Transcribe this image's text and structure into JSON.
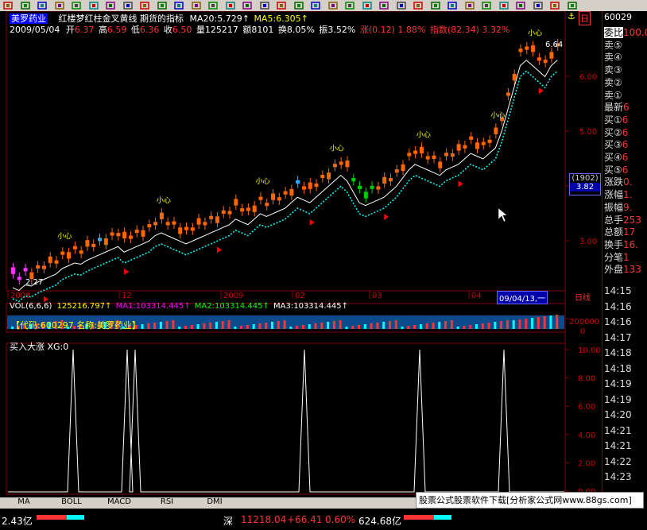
{
  "toolbar": {
    "icons": [
      "bar-chart-icon",
      "up-icon",
      "down-icon",
      "left-icon",
      "right-icon",
      "zoom-in-icon",
      "zoom-out-icon",
      "square-icon",
      "tool-icon",
      "pen-icon",
      "info-icon",
      "chart-icon",
      "line-icon",
      "grid-icon",
      "calc-icon",
      "table-icon",
      "formula-icon",
      "chart2-icon",
      "chart3-icon",
      "mail-icon",
      "calendar-icon",
      "monitor-icon",
      "close-icon",
      "question-icon",
      "search-icon",
      "person-icon",
      "eye-icon",
      "flag-icon",
      "refresh-icon",
      "image-icon",
      "doc-icon",
      "wifi-icon",
      "cross-icon",
      "help-icon"
    ]
  },
  "header": {
    "stock_name": "美罗药业",
    "indicator_title": "红楼梦红柱金叉黄线 期货的指标",
    "ma20_label": "MA20:5.729",
    "ma5_label": "MA5:6.305",
    "date": "2009/05/04",
    "open_label": "开",
    "open": "6.37",
    "high_label": "高",
    "high": "6.59",
    "low_label": "低",
    "low": "6.36",
    "close_label": "收",
    "close": "6.50",
    "vol_label": "量",
    "vol": "125217",
    "amt_label": "额",
    "amt": "8101",
    "turnover_label": "换",
    "turnover": "8.05%",
    "amplitude_label": "振",
    "amplitude": "3.52%",
    "change_label": "涨",
    "change": "(0.12)",
    "change_pct": "1.88%",
    "index_label": "指数",
    "index_val": "(82.34)",
    "index_pct": "3.32%",
    "mark_char": "日",
    "code_partial": "60029"
  },
  "chart_labels": {
    "low_point": "2.27",
    "high_point": "6.64",
    "xin_label": "小心",
    "price_ticks": [
      "6.00",
      "5.00",
      "4.00",
      "3.00"
    ],
    "date_ticks": [
      "2008",
      "12",
      "2009",
      "02",
      "03",
      "04"
    ],
    "cursor_date": "09/04/13,一",
    "cursor_box_top": "(1902)",
    "cursor_box_val": "3.82",
    "period": "日线"
  },
  "vol_panel": {
    "title": "VOL(6,6,6)",
    "vol_val": "125216.797",
    "ma1": "MA1:103314.445",
    "ma2": "MA2:103314.445",
    "ma3": "MA3:103314.445",
    "code_info": "【代码:600297 名称:美罗药业】",
    "tick_top": "200000",
    "tick_zero": "0"
  },
  "ind_panel": {
    "title": "买入大涨 XG:0",
    "ticks": [
      "10.00",
      "8.00",
      "6.00",
      "4.00",
      "2.00",
      "0.00"
    ]
  },
  "right_panel": {
    "rows": [
      {
        "label": "委比",
        "val": "100.0"
      },
      {
        "label": "卖⑤",
        "val": ""
      },
      {
        "label": "卖④",
        "val": ""
      },
      {
        "label": "卖③",
        "val": ""
      },
      {
        "label": "卖②",
        "val": ""
      },
      {
        "label": "卖①",
        "val": ""
      },
      {
        "label": "最新",
        "val": "6"
      },
      {
        "label": "买①",
        "val": "6"
      },
      {
        "label": "买②",
        "val": "6"
      },
      {
        "label": "买③",
        "val": "6"
      },
      {
        "label": "买④",
        "val": "6"
      },
      {
        "label": "买⑤",
        "val": "6"
      },
      {
        "label": "涨跌",
        "val": "0."
      },
      {
        "label": "涨幅",
        "val": "1."
      },
      {
        "label": "振幅",
        "val": "9."
      },
      {
        "label": "总手",
        "val": "253"
      },
      {
        "label": "总额",
        "val": "17"
      },
      {
        "label": "换手",
        "val": "16."
      },
      {
        "label": "分笔",
        "val": "1"
      },
      {
        "label": "外盘",
        "val": "133"
      }
    ],
    "times": [
      "14:15",
      "14:16",
      "14:16",
      "14:17",
      "14:18",
      "14:18",
      "14:19",
      "14:19",
      "14:20",
      "14:21",
      "14:21",
      "14:22",
      "14:23"
    ]
  },
  "tabs": [
    "MA",
    "BOLL",
    "MACD",
    "RSI",
    "DMI"
  ],
  "watermark": "股票公式股票软件下载[分析家公式网www.88gs.com]",
  "statusbar": {
    "left_amount": "2.43亿",
    "shen_label": "深",
    "shen_index": "11218.04",
    "shen_change": "+66.41",
    "shen_pct": "0.60%",
    "shen_amount": "624.68亿"
  }
}
